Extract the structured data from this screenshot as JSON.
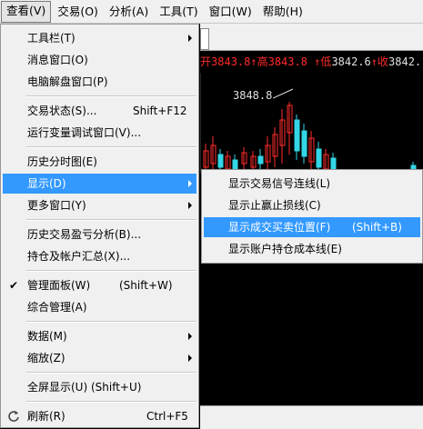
{
  "menubar": {
    "items": [
      {
        "label": "查看(V)"
      },
      {
        "label": "交易(O)"
      },
      {
        "label": "分析(A)"
      },
      {
        "label": "工具(T)"
      },
      {
        "label": "窗口(W)"
      },
      {
        "label": "帮助(H)"
      }
    ]
  },
  "quote": {
    "open_label": "开",
    "open": "3843.8",
    "high_label": "↑高",
    "high": "3843.8",
    "low_label": "↑低",
    "low": "3842.6",
    "close_label": "↑收",
    "close": "3842."
  },
  "chart_high_marker": "3848.8",
  "view_menu": {
    "items": [
      {
        "label": "工具栏(T)",
        "shortcut": ""
      },
      {
        "label": "消息窗口(O)",
        "shortcut": ""
      },
      {
        "label": "电脑解盘窗口(P)",
        "shortcut": ""
      },
      {
        "label": "交易状态(S)...",
        "shortcut": "Shift+F12"
      },
      {
        "label": "运行变量调试窗口(V)...",
        "shortcut": ""
      },
      {
        "label": "历史分时图(E)",
        "shortcut": ""
      },
      {
        "label": "显示(D)",
        "shortcut": ""
      },
      {
        "label": "更多窗口(Y)",
        "shortcut": ""
      },
      {
        "label": "历史交易盈亏分析(B)...",
        "shortcut": ""
      },
      {
        "label": "持仓及帐户汇总(X)...",
        "shortcut": ""
      },
      {
        "label": "管理面板(W)",
        "shortcut": "(Shift+W)"
      },
      {
        "label": "综合管理(A)",
        "shortcut": ""
      },
      {
        "label": "数据(M)",
        "shortcut": ""
      },
      {
        "label": "缩放(Z)",
        "shortcut": ""
      },
      {
        "label": "全屏显示(U) (Shift+U)",
        "shortcut": ""
      },
      {
        "label": "刷新(R)",
        "shortcut": "Ctrl+F5"
      }
    ]
  },
  "display_submenu": {
    "items": [
      {
        "label": "显示交易信号连线(L)",
        "shortcut": ""
      },
      {
        "label": "显示止赢止损线(C)",
        "shortcut": ""
      },
      {
        "label": "显示成交买卖位置(F)",
        "shortcut": "(Shift+B)"
      },
      {
        "label": "显示账户持仓成本线(E)",
        "shortcut": ""
      }
    ]
  },
  "colors": {
    "highlight": "#3399ff",
    "chart_up": "#ff2b2b",
    "chart_down": "#33d6e6",
    "menu_bg": "#f0f0f0"
  }
}
